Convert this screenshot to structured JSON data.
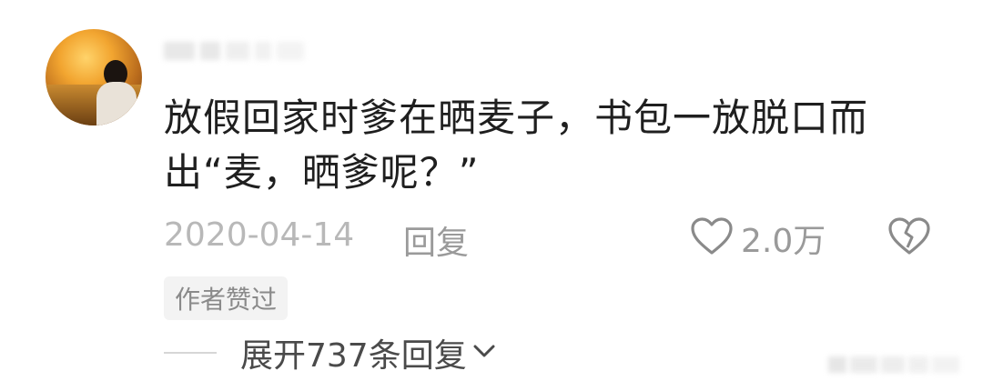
{
  "comment": {
    "text": "放假回家时爹在晒麦子，书包一放脱口而出“麦，晒爹呢？”",
    "date": "2020-04-14",
    "reply_label": "回复",
    "like_count": "2.0万",
    "author_badge": "作者赞过",
    "expand_replies": "展开737条回复"
  },
  "icons": {
    "like": "heart-outline-icon",
    "dislike": "broken-heart-icon",
    "expand": "chevron-down-icon"
  },
  "colors": {
    "text": "#1f1f1f",
    "meta": "#9a9a9a",
    "date": "#b8b8b8",
    "badge_bg": "#f3f3f3"
  }
}
